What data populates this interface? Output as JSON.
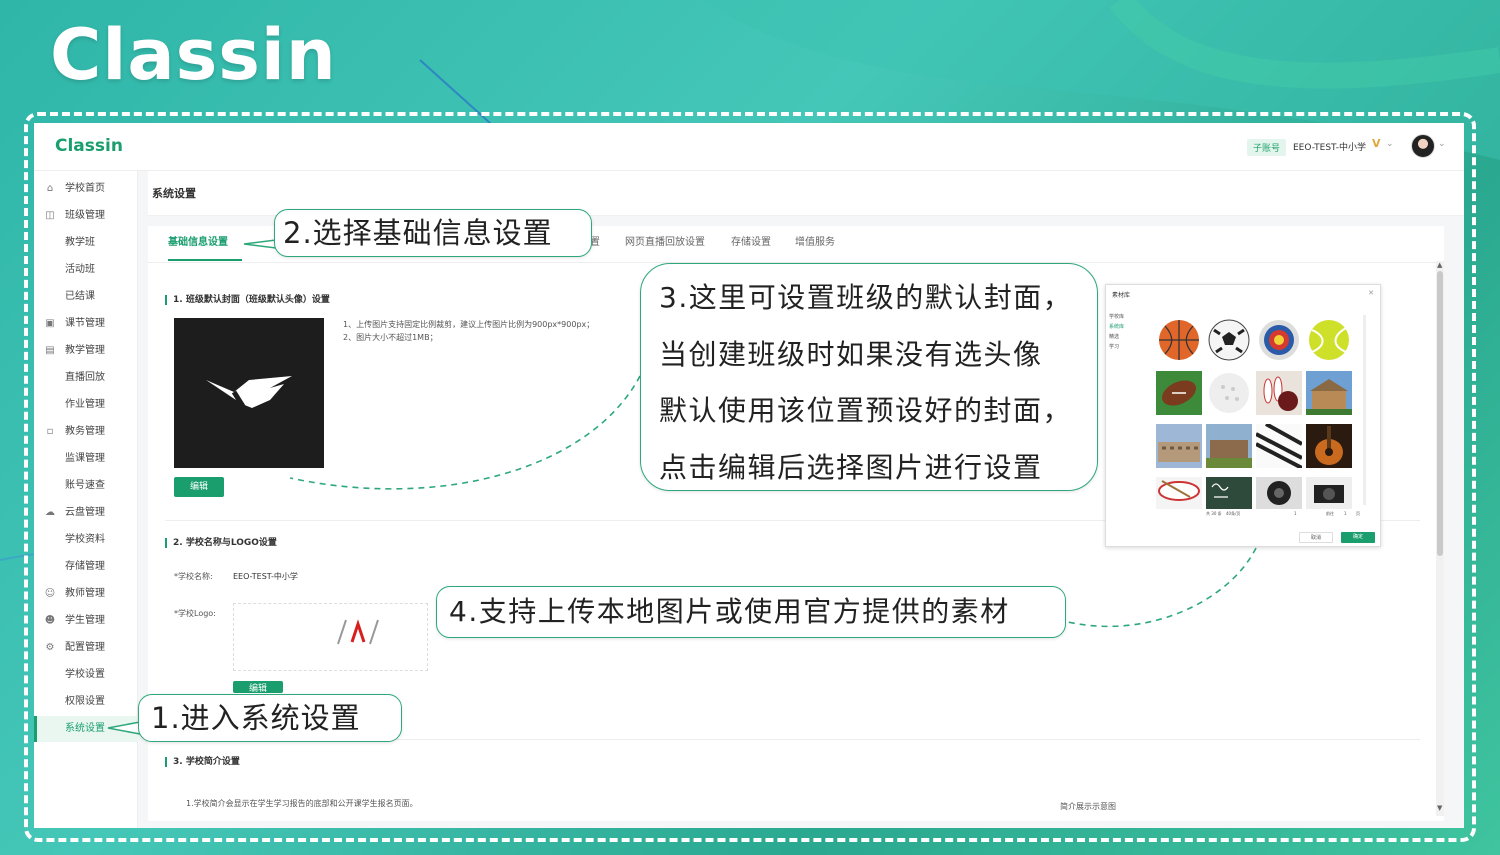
{
  "brand": "Classin",
  "app": {
    "logo": "Classin",
    "sub_badge": "子账号",
    "school": "EEO-TEST-中小学",
    "vip": "V",
    "accent": "#1a9e6e"
  },
  "sidebar": {
    "items": [
      {
        "label": "学校首页",
        "icon": "home-icon"
      },
      {
        "label": "班级管理",
        "icon": "class-icon"
      },
      {
        "label": "教学班"
      },
      {
        "label": "活动班"
      },
      {
        "label": "已结课"
      },
      {
        "label": "课节管理",
        "icon": "lesson-icon"
      },
      {
        "label": "教学管理",
        "icon": "teach-icon"
      },
      {
        "label": "直播回放"
      },
      {
        "label": "作业管理"
      },
      {
        "label": "教务管理",
        "icon": "affairs-icon"
      },
      {
        "label": "监课管理"
      },
      {
        "label": "账号速查"
      },
      {
        "label": "云盘管理",
        "icon": "cloud-icon"
      },
      {
        "label": "学校资料"
      },
      {
        "label": "存储管理"
      },
      {
        "label": "教师管理",
        "icon": "teacher-icon"
      },
      {
        "label": "学生管理",
        "icon": "student-icon"
      },
      {
        "label": "配置管理",
        "icon": "config-icon"
      },
      {
        "label": "学校设置"
      },
      {
        "label": "权限设置"
      },
      {
        "label": "系统设置"
      }
    ]
  },
  "page": {
    "title": "系统设置",
    "tabs": [
      "基础信息设置",
      "置",
      "网页直播回放设置",
      "存储设置",
      "增值服务"
    ],
    "section1": {
      "title": "1. 班级默认封面（班级默认头像）设置",
      "notes": [
        "1、上传图片支持固定比例裁剪，建议上传图片比例为900px*900px；",
        "2、图片大小不超过1MB；"
      ],
      "edit": "编辑"
    },
    "section2": {
      "title": "2. 学校名称与LOGO设置",
      "name_label": "*学校名称:",
      "name_value": "EEO-TEST-中小学",
      "logo_label": "*学校Logo:",
      "edit": "编辑"
    },
    "section3": {
      "title": "3. 学校简介设置",
      "note": "1.学校简介会显示在学生学习报告的底部和公开课学生报名页面。",
      "preview": "简介展示示意图"
    }
  },
  "dialog": {
    "title": "素材库",
    "side": [
      "学校库",
      "系统库",
      "精选",
      "学习"
    ],
    "pager": [
      "共 30 条",
      "40条/页",
      "1",
      "前往",
      "1",
      "页"
    ],
    "cancel": "取消",
    "ok": "确定"
  },
  "callouts": {
    "step1": "1.进入系统设置",
    "step2": "2.选择基础信息设置",
    "step3": [
      "3.这里可设置班级的默认封面，",
      "当创建班级时如果没有选头像",
      "默认使用该位置预设好的封面，",
      "点击编辑后选择图片进行设置"
    ],
    "step4": "4.支持上传本地图片或使用官方提供的素材"
  }
}
